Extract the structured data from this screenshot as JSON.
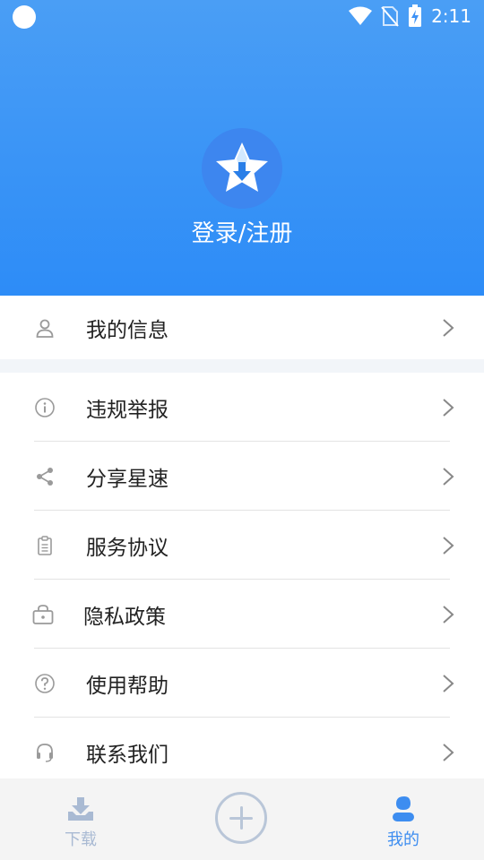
{
  "status_bar": {
    "time": "2:11",
    "icons": [
      "wifi-icon",
      "no-sim-icon",
      "battery-charging-icon"
    ]
  },
  "profile": {
    "avatar_icon": "star-download-logo",
    "login_label": "登录/注册"
  },
  "menu": {
    "group1": [
      {
        "label": "我的信息",
        "icon": "user-icon"
      }
    ],
    "group2": [
      {
        "label": "违规举报",
        "icon": "info-icon"
      },
      {
        "label": "分享星速",
        "icon": "share-icon"
      },
      {
        "label": "服务协议",
        "icon": "clipboard-icon"
      },
      {
        "label": "隐私政策",
        "icon": "lock-icon"
      },
      {
        "label": "使用帮助",
        "icon": "help-icon"
      },
      {
        "label": "联系我们",
        "icon": "headset-icon"
      }
    ]
  },
  "tabbar": {
    "download_label": "下载",
    "add_icon": "plus-circle-icon",
    "mine_label": "我的",
    "active_tab": "我的"
  },
  "colors": {
    "header_top": "#4a9ef5",
    "header_bottom": "#2d8cf7",
    "active_tab": "#3d8df0",
    "inactive_tab": "#a9bad3",
    "menu_text": "#222222",
    "menu_icon": "#9a9a9a"
  }
}
